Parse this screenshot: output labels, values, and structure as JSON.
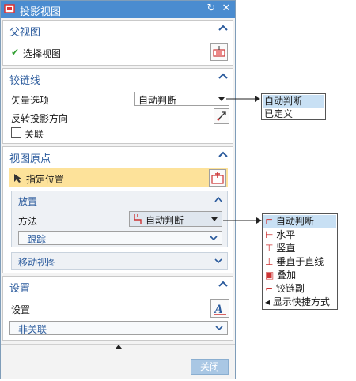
{
  "dialog": {
    "title": "投影视图",
    "reset_icon": "reset-icon",
    "close_icon": "close-icon"
  },
  "parent_view": {
    "header": "父视图",
    "select_label": "选择视图",
    "select_icon": "select-view-icon"
  },
  "hinge_line": {
    "header": "铰链线",
    "vector_option_label": "矢量选项",
    "vector_option_value": "自动判断",
    "reverse_label": "反转投影方向",
    "associate_label": "关联",
    "associate_checked": false
  },
  "view_origin": {
    "header": "视图原点",
    "specify_location_label": "指定位置",
    "placement_header": "放置",
    "method_label": "方法",
    "method_value": "自动判断",
    "align_value": "跟踪",
    "move_view_header": "移动视图"
  },
  "settings": {
    "header": "设置",
    "settings_label": "设置",
    "non_assoc_value": "非关联"
  },
  "footer": {
    "close_label": "关闭"
  },
  "vector_popup": {
    "options": [
      "自动判断",
      "已定义"
    ],
    "selected": 0
  },
  "method_popup": {
    "options": [
      "自动判断",
      "水平",
      "竖直",
      "垂直于直线",
      "叠加",
      "铰链副",
      "显示快捷方式"
    ],
    "selected": 0
  },
  "colors": {
    "titlebar": "#4a8cd0",
    "section_header_text": "#2a5a9c",
    "highlight_row": "#fde29a",
    "selected_item": "#c8e0f4",
    "check_green": "#2e9e2e"
  }
}
